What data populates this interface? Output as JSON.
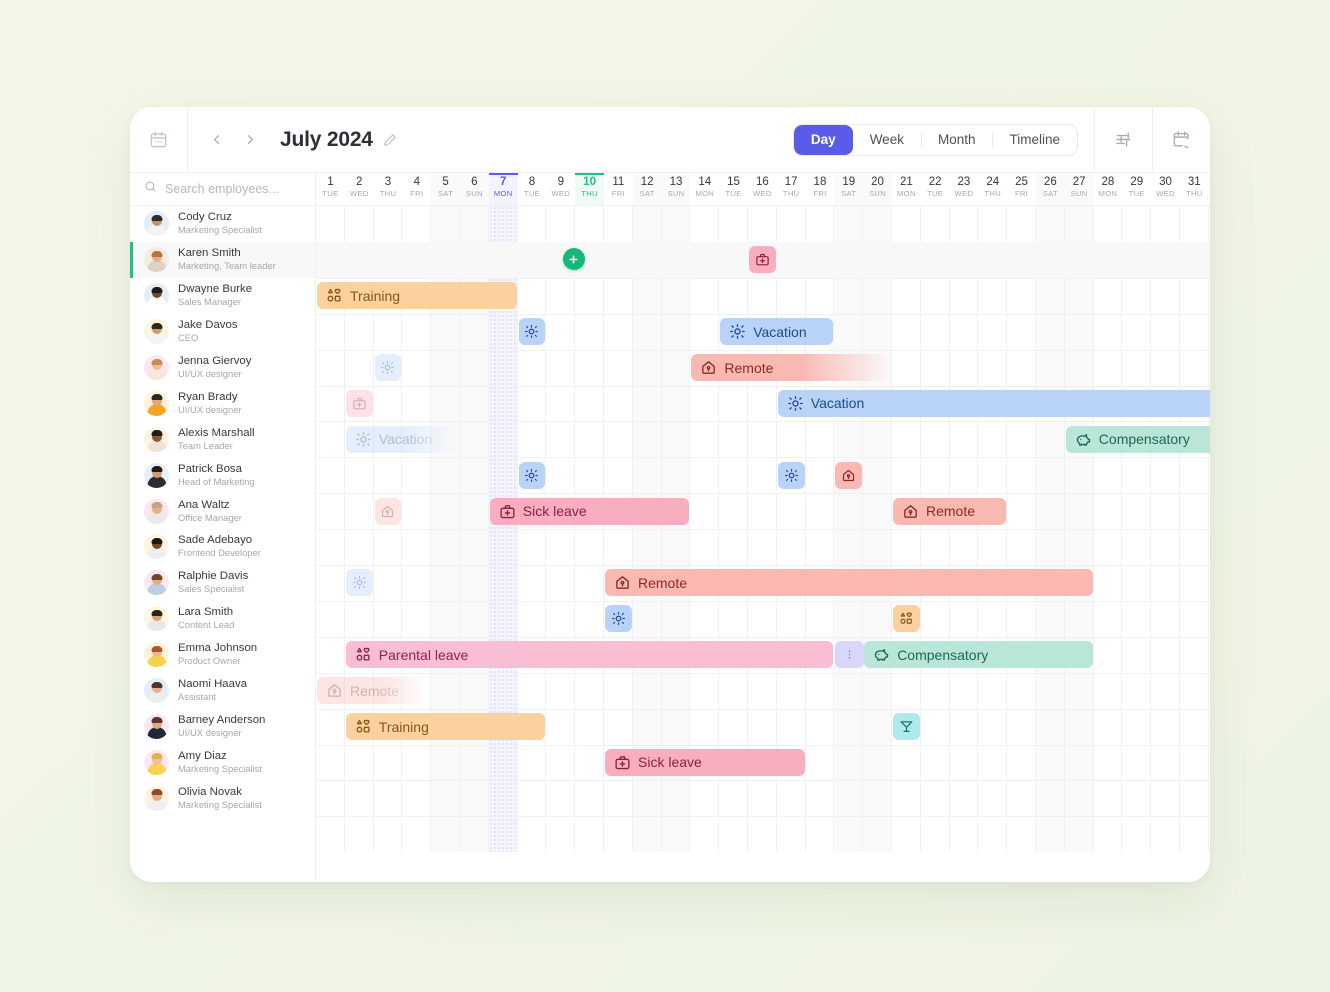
{
  "header": {
    "calendar_icon": "calendar-icon",
    "prev_label": "‹",
    "next_label": "›",
    "title": "July 2024",
    "edit_icon": "pencil-icon",
    "views": [
      {
        "label": "Day",
        "active": true
      },
      {
        "label": "Week",
        "active": false
      },
      {
        "label": "Month",
        "active": false
      },
      {
        "label": "Timeline",
        "active": false
      }
    ],
    "filter_icon": "sliders-icon",
    "schedule_icon": "calendar-settings-icon",
    "accent": "#5a5ce8"
  },
  "search": {
    "placeholder": "Search employees...",
    "value": "",
    "icon": "search-icon"
  },
  "employees": [
    {
      "name": "Cody Cruz",
      "role": "Marketing Specialist",
      "bg": "#e3edf7",
      "skin": "#c98d63",
      "shirt": "#f2f3f5",
      "hair": "#2e2b29",
      "selected": false
    },
    {
      "name": "Karen Smith",
      "role": "Marketing, Team leader",
      "bg": "#f2ece3",
      "skin": "#e8b089",
      "shirt": "#dcd3c8",
      "hair": "#b5763c",
      "selected": true
    },
    {
      "name": "Dwayne Burke",
      "role": "Sales Manager",
      "bg": "#e6eef5",
      "skin": "#6b4a34",
      "shirt": "#ffffff",
      "hair": "#1d1a18",
      "selected": false
    },
    {
      "name": "Jake Davos",
      "role": "CEO",
      "bg": "#fdf4df",
      "skin": "#d59a6c",
      "shirt": "#f3f4f6",
      "hair": "#2c2622",
      "selected": false
    },
    {
      "name": "Jenna Giervoy",
      "role": "UI/UX designer",
      "bg": "#fbe7ef",
      "skin": "#f0bd9a",
      "shirt": "#f5e7dd",
      "hair": "#c98b4f",
      "selected": false
    },
    {
      "name": "Ryan Brady",
      "role": "UI/UX designer",
      "bg": "#fdf2da",
      "skin": "#e3a875",
      "shirt": "#f4a522",
      "hair": "#2d2520",
      "selected": false
    },
    {
      "name": "Alexis Marshall",
      "role": "Team Leader",
      "bg": "#fdf4df",
      "skin": "#8a5a3c",
      "shirt": "#efe3d6",
      "hair": "#241c17",
      "selected": false
    },
    {
      "name": "Patrick Bosa",
      "role": "Head of Marketing",
      "bg": "#e8eef4",
      "skin": "#d49b72",
      "shirt": "#2b2b33",
      "hair": "#211c19",
      "selected": false
    },
    {
      "name": "Ana Waltz",
      "role": "Office Manager",
      "bg": "#fbe7ef",
      "skin": "#e9b189",
      "shirt": "#e9eaec",
      "hair": "#c9a37a",
      "selected": false
    },
    {
      "name": "Sade Adebayo",
      "role": "Frontend Developer",
      "bg": "#fdf4df",
      "skin": "#71492f",
      "shirt": "#eceef0",
      "hair": "#1b1613",
      "selected": false
    },
    {
      "name": "Ralphie Davis",
      "role": "Sales Specialist",
      "bg": "#fbe7ef",
      "skin": "#e6ab80",
      "shirt": "#b9cfe3",
      "hair": "#6b4a30",
      "selected": false
    },
    {
      "name": "Lara Smith",
      "role": "Content Lead",
      "bg": "#fdf6e0",
      "skin": "#d9a175",
      "shirt": "#e7e9eb",
      "hair": "#2a2320",
      "selected": false
    },
    {
      "name": "Emma Johnson",
      "role": "Product Owner",
      "bg": "#fdf2da",
      "skin": "#eeb68f",
      "shirt": "#f5d24a",
      "hair": "#b0552a",
      "selected": false
    },
    {
      "name": "Naomi Haava",
      "role": "Assistant",
      "bg": "#e4edf8",
      "skin": "#e8b189",
      "shirt": "#eceef0",
      "hair": "#4a352a",
      "selected": false
    },
    {
      "name": "Barney Anderson",
      "role": "UI/UX designer",
      "bg": "#fbe7ef",
      "skin": "#e3a87c",
      "shirt": "#20283a",
      "hair": "#5b3a22",
      "selected": false
    },
    {
      "name": "Amy Diaz",
      "role": "Marketing Specialist",
      "bg": "#fbe7ef",
      "skin": "#f0be97",
      "shirt": "#f6d44e",
      "hair": "#e0b24a",
      "selected": false
    },
    {
      "name": "Olivia Novak",
      "role": "Marketing Specialist",
      "bg": "#fdf4df",
      "skin": "#e5ac82",
      "shirt": "#eceef0",
      "hair": "#8d4a2a",
      "selected": false
    }
  ],
  "days": [
    {
      "num": "1",
      "dow": "TUE",
      "weekend": false,
      "selected": false,
      "today": false
    },
    {
      "num": "2",
      "dow": "WED",
      "weekend": false,
      "selected": false,
      "today": false
    },
    {
      "num": "3",
      "dow": "THU",
      "weekend": false,
      "selected": false,
      "today": false
    },
    {
      "num": "4",
      "dow": "FRI",
      "weekend": false,
      "selected": false,
      "today": false
    },
    {
      "num": "5",
      "dow": "SAT",
      "weekend": true,
      "selected": false,
      "today": false
    },
    {
      "num": "6",
      "dow": "SUN",
      "weekend": true,
      "selected": false,
      "today": false
    },
    {
      "num": "7",
      "dow": "MON",
      "weekend": false,
      "selected": true,
      "today": false
    },
    {
      "num": "8",
      "dow": "TUE",
      "weekend": false,
      "selected": false,
      "today": false
    },
    {
      "num": "9",
      "dow": "WED",
      "weekend": false,
      "selected": false,
      "today": false
    },
    {
      "num": "10",
      "dow": "THU",
      "weekend": false,
      "selected": false,
      "today": true
    },
    {
      "num": "11",
      "dow": "FRI",
      "weekend": false,
      "selected": false,
      "today": false
    },
    {
      "num": "12",
      "dow": "SAT",
      "weekend": true,
      "selected": false,
      "today": false
    },
    {
      "num": "13",
      "dow": "SUN",
      "weekend": true,
      "selected": false,
      "today": false
    },
    {
      "num": "14",
      "dow": "MON",
      "weekend": false,
      "selected": false,
      "today": false
    },
    {
      "num": "15",
      "dow": "TUE",
      "weekend": false,
      "selected": false,
      "today": false
    },
    {
      "num": "16",
      "dow": "WED",
      "weekend": false,
      "selected": false,
      "today": false
    },
    {
      "num": "17",
      "dow": "THU",
      "weekend": false,
      "selected": false,
      "today": false
    },
    {
      "num": "18",
      "dow": "FRI",
      "weekend": false,
      "selected": false,
      "today": false
    },
    {
      "num": "19",
      "dow": "SAT",
      "weekend": true,
      "selected": false,
      "today": false
    },
    {
      "num": "20",
      "dow": "SUN",
      "weekend": true,
      "selected": false,
      "today": false
    },
    {
      "num": "21",
      "dow": "MON",
      "weekend": false,
      "selected": false,
      "today": false
    },
    {
      "num": "22",
      "dow": "TUE",
      "weekend": false,
      "selected": false,
      "today": false
    },
    {
      "num": "23",
      "dow": "WED",
      "weekend": false,
      "selected": false,
      "today": false
    },
    {
      "num": "24",
      "dow": "THU",
      "weekend": false,
      "selected": false,
      "today": false
    },
    {
      "num": "25",
      "dow": "FRI",
      "weekend": false,
      "selected": false,
      "today": false
    },
    {
      "num": "26",
      "dow": "SAT",
      "weekend": true,
      "selected": false,
      "today": false
    },
    {
      "num": "27",
      "dow": "SUN",
      "weekend": true,
      "selected": false,
      "today": false
    },
    {
      "num": "28",
      "dow": "MON",
      "weekend": false,
      "selected": false,
      "today": false
    },
    {
      "num": "29",
      "dow": "TUE",
      "weekend": false,
      "selected": false,
      "today": false
    },
    {
      "num": "30",
      "dow": "WED",
      "weekend": false,
      "selected": false,
      "today": false
    },
    {
      "num": "31",
      "dow": "THU",
      "weekend": false,
      "selected": false,
      "today": false
    }
  ],
  "event_types": {
    "vacation": {
      "label": "Vacation",
      "icon": "sun-icon",
      "bg": "#b9d2f7",
      "fg": "#1e4c8a"
    },
    "sick": {
      "label": "Sick leave",
      "icon": "medkit-icon",
      "bg": "#f9aebf",
      "fg": "#8d1f3a"
    },
    "compensatory": {
      "label": "Compensatory",
      "icon": "piggy-icon",
      "bg": "#b9e6d8",
      "fg": "#1b6953"
    },
    "remote": {
      "label": "Remote",
      "icon": "home-icon",
      "bg": "#fab8b2",
      "fg": "#8c2b20"
    },
    "training": {
      "label": "Training",
      "icon": "shapes-icon",
      "bg": "#fbd1a0",
      "fg": "#8a5616"
    },
    "parental": {
      "label": "Parental leave",
      "icon": "shapes-icon",
      "bg": "#f9bdd4",
      "fg": "#8d2350"
    },
    "cocktail": {
      "label": "Day off",
      "icon": "cocktail-icon",
      "bg": "#aeeaea",
      "fg": "#14706f"
    }
  },
  "events": [
    {
      "row": 1,
      "start": 1,
      "span": 1,
      "type": "add",
      "label": "",
      "variant": "add"
    },
    {
      "row": 1,
      "start": 16,
      "span": 1,
      "type": "sick",
      "label": "",
      "variant": "square"
    },
    {
      "row": 2,
      "start": 1,
      "span": 7,
      "type": "training",
      "label": "Training",
      "variant": "bar"
    },
    {
      "row": 3,
      "start": 8,
      "span": 1,
      "type": "vacation",
      "label": "",
      "variant": "square"
    },
    {
      "row": 3,
      "start": 15,
      "span": 4,
      "type": "vacation",
      "label": "Vacation",
      "variant": "bar"
    },
    {
      "row": 4,
      "start": 3,
      "span": 1,
      "type": "vacation",
      "label": "",
      "variant": "square-faded"
    },
    {
      "row": 4,
      "start": 14,
      "span": 7,
      "type": "remote",
      "label": "Remote",
      "variant": "bar-fade-right"
    },
    {
      "row": 5,
      "start": 2,
      "span": 1,
      "type": "sick",
      "label": "",
      "variant": "square-faded-hatched"
    },
    {
      "row": 5,
      "start": 17,
      "span": 16,
      "type": "vacation",
      "label": "Vacation",
      "variant": "bar"
    },
    {
      "row": 6,
      "start": 2,
      "span": 4,
      "type": "vacation",
      "label": "Vacation",
      "variant": "bar-faded-fade-right"
    },
    {
      "row": 6,
      "start": 27,
      "span": 6,
      "type": "compensatory",
      "label": "Compensatory",
      "variant": "bar"
    },
    {
      "row": 7,
      "start": 8,
      "span": 1,
      "type": "vacation",
      "label": "",
      "variant": "square"
    },
    {
      "row": 7,
      "start": 17,
      "span": 1,
      "type": "vacation",
      "label": "",
      "variant": "square"
    },
    {
      "row": 7,
      "start": 19,
      "span": 1,
      "type": "remote",
      "label": "",
      "variant": "square"
    },
    {
      "row": 8,
      "start": 3,
      "span": 1,
      "type": "remote",
      "label": "",
      "variant": "square-faded-hatched"
    },
    {
      "row": 8,
      "start": 7,
      "span": 7,
      "type": "sick",
      "label": "Sick leave",
      "variant": "bar"
    },
    {
      "row": 8,
      "start": 21,
      "span": 4,
      "type": "remote",
      "label": "Remote",
      "variant": "bar"
    },
    {
      "row": 10,
      "start": 2,
      "span": 1,
      "type": "vacation",
      "label": "",
      "variant": "square-faded"
    },
    {
      "row": 10,
      "start": 11,
      "span": 17,
      "type": "remote",
      "label": "Remote",
      "variant": "bar-hatched"
    },
    {
      "row": 11,
      "start": 11,
      "span": 1,
      "type": "vacation",
      "label": "",
      "variant": "square"
    },
    {
      "row": 11,
      "start": 21,
      "span": 1,
      "type": "training",
      "label": "",
      "variant": "square"
    },
    {
      "row": 12,
      "start": 2,
      "span": 17,
      "type": "parental",
      "label": "Parental leave",
      "variant": "bar"
    },
    {
      "row": 12,
      "start": 19,
      "span": 1,
      "type": "more",
      "label": "⋮",
      "variant": "more"
    },
    {
      "row": 12,
      "start": 20,
      "span": 8,
      "type": "compensatory",
      "label": "Compensatory",
      "variant": "bar"
    },
    {
      "row": 13,
      "start": 1,
      "span": 4,
      "type": "remote",
      "label": "Remote",
      "variant": "bar-faded-hatched-fade-right"
    },
    {
      "row": 14,
      "start": 2,
      "span": 7,
      "type": "training",
      "label": "Training",
      "variant": "bar"
    },
    {
      "row": 14,
      "start": 21,
      "span": 1,
      "type": "cocktail",
      "label": "",
      "variant": "square"
    },
    {
      "row": 15,
      "start": 11,
      "span": 7,
      "type": "sick",
      "label": "Sick leave",
      "variant": "bar"
    }
  ],
  "legend": {
    "groups": [
      [
        {
          "name": "vacation-legend",
          "icon": "sun-icon",
          "bg": "#cfe2fb",
          "fg": "#3b82dd"
        },
        {
          "name": "sick-leave-legend",
          "icon": "medkit-icon",
          "bg": "#fbc6d2",
          "fg": "#e9406e"
        },
        {
          "name": "compensatory-legend",
          "icon": "piggy-icon",
          "bg": "#cfeee2",
          "fg": "#3db693"
        },
        {
          "name": "remote-legend",
          "icon": "home-icon",
          "bg": "#fbcdc6",
          "fg": "#f0715e"
        },
        {
          "name": "training-legend",
          "icon": "shapes-icon",
          "bg": "#fde0b4",
          "fg": "#f0a62c"
        },
        {
          "name": "business-trip-legend",
          "icon": "building-plus-icon",
          "bg": "#e6e8ea",
          "fg": "#8d949c"
        }
      ],
      [
        {
          "name": "holiday-legend",
          "icon": "star-badge-icon",
          "bg": "#ddd5fb",
          "fg": "#8b5cf0"
        },
        {
          "name": "day-off-legend",
          "icon": "cocktail-icon",
          "bg": "#c6eef0",
          "fg": "#37c4cc"
        }
      ],
      [
        {
          "name": "birthday-legend",
          "icon": "cake-icon",
          "bg": "#fbcbdd",
          "fg": "#ea5d90"
        },
        {
          "name": "anniversary-legend",
          "icon": "ring-icon",
          "bg": "#e7d8bf",
          "fg": "#b08a4e"
        },
        {
          "name": "onboarding-legend",
          "icon": "person-plus-icon",
          "bg": "#cdeed6",
          "fg": "#45b870"
        },
        {
          "name": "probation-legend",
          "icon": "clipboard-icon",
          "bg": "#fcd9ae",
          "fg": "#ef9a33"
        },
        {
          "name": "offboarding-legend",
          "icon": "exit-icon",
          "bg": "#e6e8ea",
          "fg": "#8d949c"
        }
      ]
    ],
    "settings_icon": "calendar-gear-icon"
  }
}
